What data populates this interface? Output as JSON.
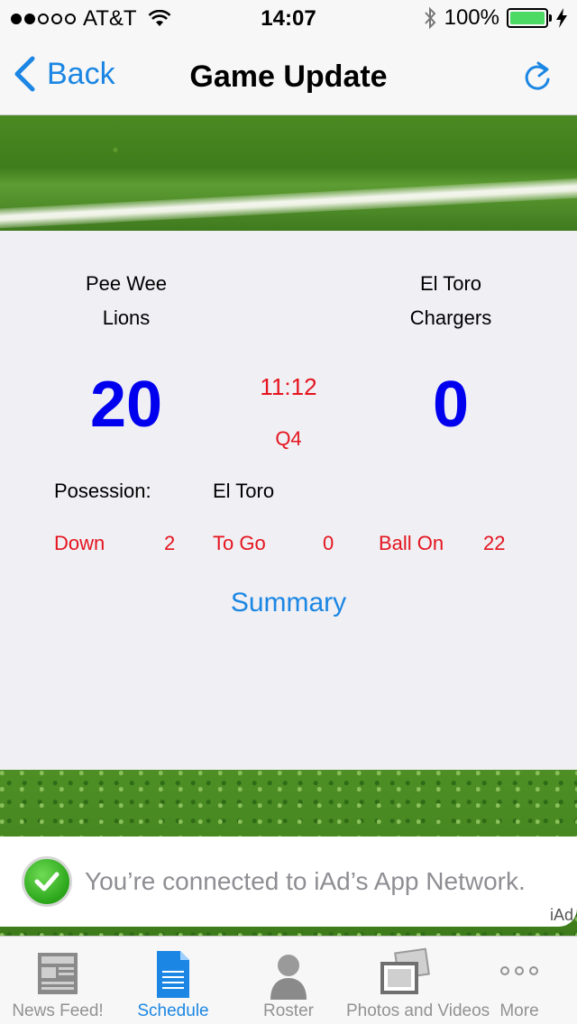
{
  "status_bar": {
    "carrier": "AT&T",
    "time": "14:07",
    "battery": "100%"
  },
  "nav": {
    "back_label": "Back",
    "title": "Game Update"
  },
  "game": {
    "home": {
      "line1": "Pee Wee",
      "line2": "Lions",
      "score": "20"
    },
    "away": {
      "line1": "El Toro",
      "line2": "Chargers",
      "score": "0"
    },
    "clock": "11:12",
    "quarter": "Q4",
    "possession_label": "Posession:",
    "possession_value": "El Toro",
    "stats": {
      "down_label": "Down",
      "down_value": "2",
      "togo_label": "To Go",
      "togo_value": "0",
      "ballon_label": "Ball On",
      "ballon_value": "22"
    },
    "summary_label": "Summary"
  },
  "ad": {
    "message": "You’re connected to iAd’s App Network.",
    "tag": "iAd"
  },
  "tabs": [
    {
      "label": "News Feed!",
      "icon": "newspaper-icon"
    },
    {
      "label": "Schedule",
      "icon": "document-icon",
      "active": true
    },
    {
      "label": "Roster",
      "icon": "person-icon"
    },
    {
      "label": "Photos and Videos",
      "icon": "photos-icon"
    },
    {
      "label": "More",
      "icon": "more-icon"
    }
  ],
  "colors": {
    "accent": "#1b86e3",
    "score": "#0000ee",
    "alert": "#e5141e",
    "battery": "#4cd964"
  }
}
